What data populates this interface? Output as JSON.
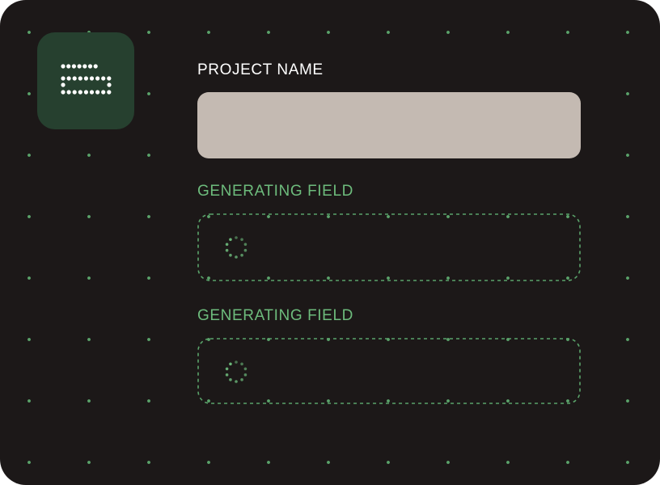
{
  "form": {
    "project_name_label": "PROJECT NAME",
    "project_name_value": "",
    "generating_field_1_label": "GENERATING FIELD",
    "generating_field_2_label": "GENERATING FIELD"
  },
  "icons": {
    "app_icon": "dotted-form-icon",
    "loader": "dotted-spinner-icon"
  },
  "colors": {
    "background": "#1c1818",
    "dot_grid": "#5aa36a",
    "accent_green": "#6dbb7c",
    "app_icon_bg": "#26402f",
    "input_fill": "#c4bab2",
    "label_white": "#ffffff"
  }
}
